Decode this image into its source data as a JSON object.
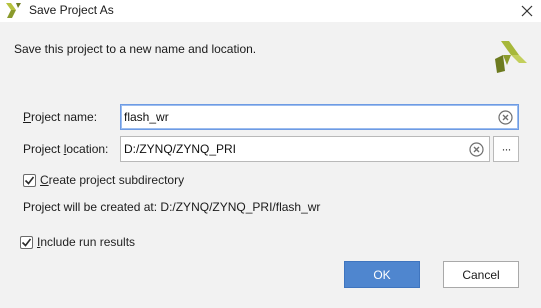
{
  "window": {
    "title": "Save Project As",
    "close_icon": "close-icon"
  },
  "header": {
    "subtitle": "Save this project to a new name and location."
  },
  "form": {
    "project_name": {
      "label_prefix": "P",
      "label_rest": "roject name:",
      "value": "flash_wr"
    },
    "project_location": {
      "label_prefix": "Project ",
      "label_underlined": "l",
      "label_rest": "ocation:",
      "value": "D:/ZYNQ/ZYNQ_PRI",
      "browse_label": "···"
    },
    "create_subdirectory": {
      "label_underlined": "C",
      "label_rest": "reate project subdirectory",
      "checked": true
    },
    "info": "Project will be created at: D:/ZYNQ/ZYNQ_PRI/flash_wr",
    "include_run_results": {
      "label_underlined": "I",
      "label_rest": "nclude run results",
      "checked": true
    }
  },
  "buttons": {
    "ok": "OK",
    "cancel": "Cancel"
  },
  "colors": {
    "accent": "#4f86cf",
    "logo_green": "#a3b43a",
    "logo_dark": "#5f6b1d"
  }
}
